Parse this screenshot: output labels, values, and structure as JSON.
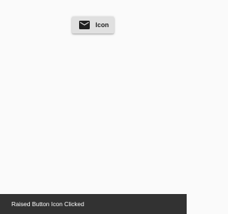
{
  "raised_button": {
    "icon": "mail-icon",
    "label": "Icon",
    "background": "#e0e0e0"
  },
  "snackbar": {
    "message": "Raised Button Icon Clicked",
    "background": "#323232"
  }
}
